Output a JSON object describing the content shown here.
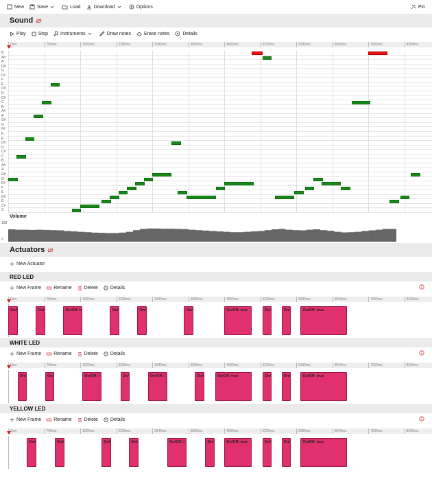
{
  "toolbar": {
    "new": "New",
    "save": "Save",
    "load": "Load",
    "download": "Download",
    "options": "Options",
    "pin": "Pin"
  },
  "sound": {
    "title": "Sound",
    "controls": {
      "play": "Play",
      "stop": "Stop",
      "instruments": "Instruments",
      "draw": "Draw notes",
      "erase": "Erase notes",
      "details": "Details"
    },
    "volume_label": "Volume",
    "volume_max": "100",
    "volume_min": "0"
  },
  "timeline": [
    "0ms",
    "760ms",
    "1520ms",
    "2280ms",
    "3040ms",
    "3800ms",
    "4560ms",
    "5320ms",
    "6080ms",
    "6840ms",
    "7600ms",
    "8360ms"
  ],
  "keys": [
    "B",
    "A#",
    "A",
    "G#",
    "G",
    "F#",
    "F",
    "E",
    "D#",
    "D",
    "C#",
    "C",
    "B",
    "A#",
    "A",
    "G#",
    "G",
    "F#",
    "F",
    "E",
    "D#",
    "D",
    "C#",
    "C",
    "B",
    "A#",
    "A",
    "G#",
    "G",
    "F#",
    "F",
    "E",
    "D#",
    "D",
    "C#",
    "C"
  ],
  "notes": [
    {
      "row": 0,
      "start": 0.575,
      "len": 0.025,
      "red": true
    },
    {
      "row": 1,
      "start": 0.6,
      "len": 0.022
    },
    {
      "row": 0,
      "start": 0.85,
      "len": 0.045,
      "red": true
    },
    {
      "row": 7,
      "start": 0.1,
      "len": 0.022
    },
    {
      "row": 11,
      "start": 0.08,
      "len": 0.022
    },
    {
      "row": 11,
      "start": 0.81,
      "len": 0.045
    },
    {
      "row": 14,
      "start": 0.06,
      "len": 0.022
    },
    {
      "row": 19,
      "start": 0.04,
      "len": 0.022
    },
    {
      "row": 20,
      "start": 0.385,
      "len": 0.022
    },
    {
      "row": 23,
      "start": 0.02,
      "len": 0.022
    },
    {
      "row": 27,
      "start": 0.34,
      "len": 0.045
    },
    {
      "row": 27,
      "start": 0.95,
      "len": 0.022
    },
    {
      "row": 28,
      "start": 0.0,
      "len": 0.022
    },
    {
      "row": 28,
      "start": 0.32,
      "len": 0.022
    },
    {
      "row": 28,
      "start": 0.72,
      "len": 0.022
    },
    {
      "row": 29,
      "start": 0.3,
      "len": 0.022
    },
    {
      "row": 29,
      "start": 0.51,
      "len": 0.07
    },
    {
      "row": 29,
      "start": 0.74,
      "len": 0.045
    },
    {
      "row": 30,
      "start": 0.28,
      "len": 0.022
    },
    {
      "row": 30,
      "start": 0.49,
      "len": 0.022
    },
    {
      "row": 30,
      "start": 0.7,
      "len": 0.022
    },
    {
      "row": 30,
      "start": 0.785,
      "len": 0.022
    },
    {
      "row": 31,
      "start": 0.26,
      "len": 0.022
    },
    {
      "row": 31,
      "start": 0.4,
      "len": 0.022
    },
    {
      "row": 31,
      "start": 0.675,
      "len": 0.022
    },
    {
      "row": 32,
      "start": 0.24,
      "len": 0.022
    },
    {
      "row": 32,
      "start": 0.42,
      "len": 0.07
    },
    {
      "row": 32,
      "start": 0.63,
      "len": 0.045
    },
    {
      "row": 32,
      "start": 0.925,
      "len": 0.022
    },
    {
      "row": 33,
      "start": 0.22,
      "len": 0.022
    },
    {
      "row": 33,
      "start": 0.9,
      "len": 0.022
    },
    {
      "row": 34,
      "start": 0.17,
      "len": 0.045
    },
    {
      "row": 35,
      "start": 0.15,
      "len": 0.022
    }
  ],
  "volume": [
    60,
    58,
    58,
    57,
    58,
    57,
    56,
    55,
    52,
    50,
    48,
    46,
    44,
    43,
    42,
    42,
    44,
    48,
    56,
    62,
    64,
    64,
    63,
    63,
    62,
    61,
    58,
    56,
    54,
    52,
    50,
    48,
    46,
    46,
    48,
    50,
    52,
    56,
    60,
    62,
    58,
    56,
    55,
    58,
    60,
    56,
    53,
    48,
    45,
    46,
    48,
    52,
    55,
    58,
    62,
    62
  ],
  "actuators": {
    "title": "Actuators",
    "new_actuator": "New Actuator",
    "frame_controls": {
      "new_frame": "New Frame",
      "rename": "Rename",
      "delete": "Delete",
      "details": "Details"
    },
    "leds": [
      {
        "name": "RED LED",
        "frames": [
          {
            "start": 0.0,
            "len": 0.022,
            "label": "On/f"
          },
          {
            "start": 0.065,
            "len": 0.022,
            "label": "On/f"
          },
          {
            "start": 0.13,
            "len": 0.045,
            "label": "On/Off: tr"
          },
          {
            "start": 0.24,
            "len": 0.022,
            "label": "On/f"
          },
          {
            "start": 0.305,
            "len": 0.022,
            "label": "On/f"
          },
          {
            "start": 0.415,
            "len": 0.022,
            "label": "On/f"
          },
          {
            "start": 0.51,
            "len": 0.065,
            "label": "On/Off: true"
          },
          {
            "start": 0.6,
            "len": 0.022,
            "label": "On/f"
          },
          {
            "start": 0.645,
            "len": 0.022,
            "label": "On/f"
          },
          {
            "start": 0.69,
            "len": 0.11,
            "label": "On/Off: true"
          }
        ]
      },
      {
        "name": "WHITE LED",
        "frames": [
          {
            "start": 0.022,
            "len": 0.022,
            "label": "On/f"
          },
          {
            "start": 0.087,
            "len": 0.022,
            "label": "On/f"
          },
          {
            "start": 0.175,
            "len": 0.045,
            "label": "On/Off: t"
          },
          {
            "start": 0.265,
            "len": 0.022,
            "label": "On/f"
          },
          {
            "start": 0.33,
            "len": 0.045,
            "label": "On/Off: t"
          },
          {
            "start": 0.44,
            "len": 0.022,
            "label": "On/f"
          },
          {
            "start": 0.488,
            "len": 0.087,
            "label": "On/Off: true"
          },
          {
            "start": 0.6,
            "len": 0.022,
            "label": "On/f"
          },
          {
            "start": 0.645,
            "len": 0.022,
            "label": "On/f"
          },
          {
            "start": 0.69,
            "len": 0.11,
            "label": "On/Off: true"
          }
        ]
      },
      {
        "name": "YELLOW LED",
        "frames": [
          {
            "start": 0.044,
            "len": 0.022,
            "label": "On/f"
          },
          {
            "start": 0.11,
            "len": 0.022,
            "label": "On/f"
          },
          {
            "start": 0.22,
            "len": 0.022,
            "label": "On/f"
          },
          {
            "start": 0.285,
            "len": 0.022,
            "label": "On/f"
          },
          {
            "start": 0.375,
            "len": 0.045,
            "label": "On/Off: t"
          },
          {
            "start": 0.465,
            "len": 0.022,
            "label": "On/f"
          },
          {
            "start": 0.51,
            "len": 0.065,
            "label": "On/Off: true"
          },
          {
            "start": 0.6,
            "len": 0.022,
            "label": "On/f"
          },
          {
            "start": 0.645,
            "len": 0.022,
            "label": "On/f"
          },
          {
            "start": 0.69,
            "len": 0.11,
            "label": "On/Off: true"
          }
        ]
      }
    ]
  }
}
